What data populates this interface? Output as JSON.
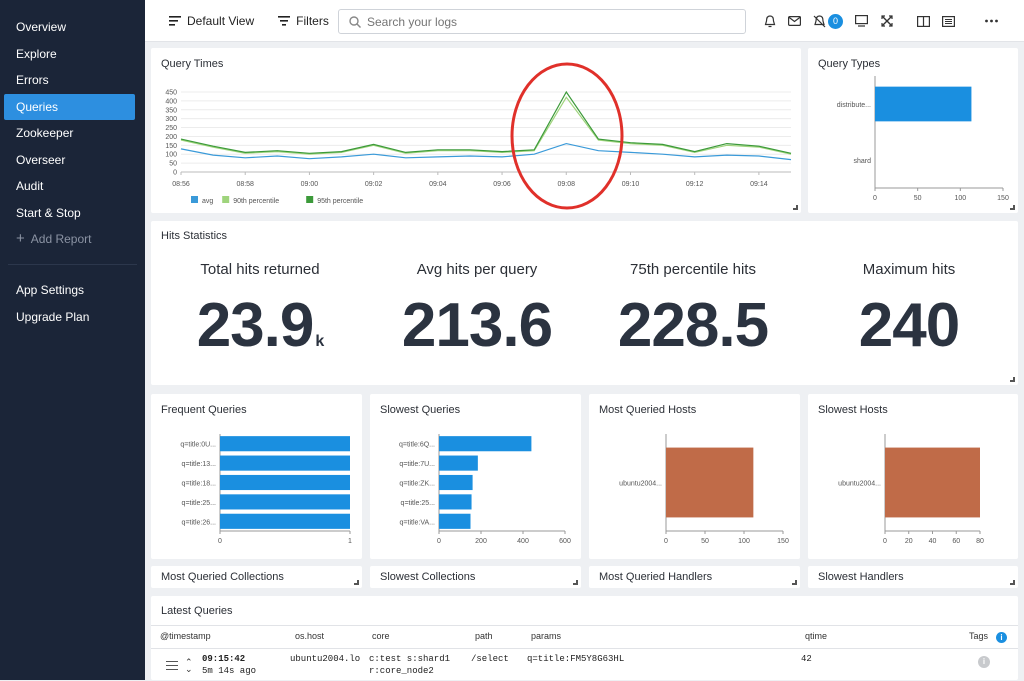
{
  "sidebar": {
    "items": [
      {
        "label": "Overview"
      },
      {
        "label": "Explore"
      },
      {
        "label": "Errors"
      },
      {
        "label": "Queries"
      },
      {
        "label": "Zookeeper"
      },
      {
        "label": "Overseer"
      },
      {
        "label": "Audit"
      },
      {
        "label": "Start & Stop"
      }
    ],
    "add_label": "Add Report",
    "bottom": [
      {
        "label": "App Settings"
      },
      {
        "label": "Upgrade Plan"
      }
    ]
  },
  "topbar": {
    "view_label": "Default View",
    "filters_label": "Filters",
    "search_placeholder": "Search your logs",
    "badge_count": "0"
  },
  "query_times": {
    "title": "Query Times",
    "legend": [
      "avg",
      "90th percentile",
      "95th percentile"
    ],
    "y_ticks": [
      "450",
      "400",
      "350",
      "300",
      "250",
      "200",
      "150",
      "100",
      "50",
      "0"
    ],
    "x_ticks": [
      "08:56",
      "08:58",
      "09:00",
      "09:02",
      "09:04",
      "09:06",
      "09:08",
      "09:10",
      "09:12",
      "09:14"
    ]
  },
  "query_types": {
    "title": "Query Types",
    "labels": [
      "distribute...",
      "shard"
    ],
    "x_ticks": [
      "0",
      "50",
      "100",
      "150"
    ]
  },
  "hits": {
    "title": "Hits Statistics",
    "stats": [
      {
        "label": "Total hits returned",
        "value": "23.9",
        "suffix": "k"
      },
      {
        "label": "Avg hits per query",
        "value": "213.6",
        "suffix": ""
      },
      {
        "label": "75th percentile hits",
        "value": "228.5",
        "suffix": ""
      },
      {
        "label": "Maximum hits",
        "value": "240",
        "suffix": ""
      }
    ]
  },
  "frequent": {
    "title": "Frequent Queries",
    "labels": [
      "q=title:0U...",
      "q=title:13...",
      "q=title:18...",
      "q=title:25...",
      "q=title:26..."
    ],
    "x_ticks": [
      "0",
      "1"
    ]
  },
  "slowest": {
    "title": "Slowest Queries",
    "labels": [
      "q=title:6Q...",
      "q=title:7U...",
      "q=title:ZK...",
      "q=title:25...",
      "q=title:VA..."
    ],
    "x_ticks": [
      "0",
      "200",
      "400",
      "600"
    ]
  },
  "most_hosts": {
    "title": "Most Queried Hosts",
    "labels": [
      "ubuntu2004..."
    ],
    "x_ticks": [
      "0",
      "50",
      "100",
      "150"
    ]
  },
  "slow_hosts": {
    "title": "Slowest Hosts",
    "labels": [
      "ubuntu2004..."
    ],
    "x_ticks": [
      "0",
      "20",
      "40",
      "60",
      "80"
    ]
  },
  "row3": {
    "a": "Most Queried Collections",
    "b": "Slowest Collections",
    "c": "Most Queried Handlers",
    "d": "Slowest Handlers"
  },
  "latest": {
    "title": "Latest Queries",
    "headers": [
      "@timestamp",
      "os.host",
      "core",
      "path",
      "params",
      "qtime",
      "Tags"
    ],
    "row": {
      "time": "09:15:42",
      "ago": "5m 14s ago",
      "host": "ubuntu2004.lo",
      "core1": "c:test s:shard1",
      "core2": "r:core_node2",
      "path": "/select",
      "params": "q=title:FM5Y8G63HL",
      "qtime": "42"
    }
  },
  "chart_data": [
    {
      "type": "line",
      "title": "Query Times",
      "x": [
        "08:56",
        "08:57",
        "08:58",
        "08:59",
        "09:00",
        "09:01",
        "09:02",
        "09:03",
        "09:04",
        "09:05",
        "09:06",
        "09:07",
        "09:08",
        "09:09",
        "09:10",
        "09:11",
        "09:12",
        "09:13",
        "09:14",
        "09:15"
      ],
      "series": [
        {
          "name": "avg",
          "color": "#3a9ad9",
          "values": [
            130,
            95,
            80,
            90,
            75,
            85,
            100,
            80,
            85,
            90,
            85,
            100,
            160,
            120,
            110,
            100,
            85,
            95,
            90,
            70
          ]
        },
        {
          "name": "90th percentile",
          "color": "#9fd47c",
          "values": [
            180,
            140,
            105,
            115,
            100,
            110,
            150,
            105,
            120,
            120,
            110,
            120,
            420,
            180,
            160,
            150,
            110,
            150,
            140,
            100
          ]
        },
        {
          "name": "95th percentile",
          "color": "#3c9a3a",
          "values": [
            185,
            145,
            110,
            120,
            105,
            115,
            155,
            110,
            125,
            125,
            115,
            125,
            450,
            185,
            165,
            155,
            115,
            160,
            145,
            105
          ]
        }
      ],
      "ylim": [
        0,
        450
      ]
    },
    {
      "type": "bar",
      "title": "Query Types",
      "categories": [
        "distribute...",
        "shard"
      ],
      "values": [
        113,
        0
      ],
      "xlim": [
        0,
        150
      ],
      "color": "#1a8fe0"
    },
    {
      "type": "bar",
      "title": "Frequent Queries",
      "categories": [
        "q=title:0U...",
        "q=title:13...",
        "q=title:18...",
        "q=title:25...",
        "q=title:26..."
      ],
      "values": [
        1,
        1,
        1,
        1,
        1
      ],
      "xlim": [
        0,
        1
      ],
      "color": "#1a8fe0"
    },
    {
      "type": "bar",
      "title": "Slowest Queries",
      "categories": [
        "q=title:6Q...",
        "q=title:7U...",
        "q=title:ZK...",
        "q=title:25...",
        "q=title:VA..."
      ],
      "values": [
        440,
        185,
        160,
        155,
        150
      ],
      "xlim": [
        0,
        600
      ],
      "color": "#1a8fe0"
    },
    {
      "type": "bar",
      "title": "Most Queried Hosts",
      "categories": [
        "ubuntu2004..."
      ],
      "values": [
        112
      ],
      "xlim": [
        0,
        150
      ],
      "color": "#c06b48"
    },
    {
      "type": "bar",
      "title": "Slowest Hosts",
      "categories": [
        "ubuntu2004..."
      ],
      "values": [
        80
      ],
      "xlim": [
        0,
        80
      ],
      "color": "#c06b48"
    }
  ]
}
